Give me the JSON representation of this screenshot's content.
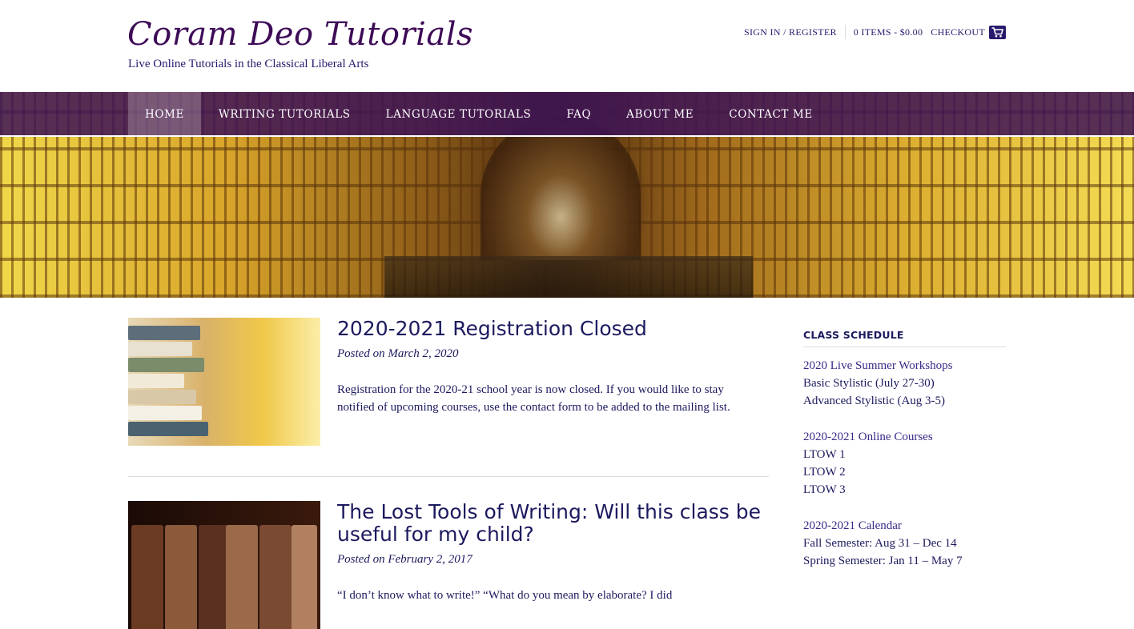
{
  "site": {
    "title": "Coram Deo Tutorials",
    "tagline": "Live Online Tutorials in the Classical Liberal Arts"
  },
  "topbar": {
    "signin": "SIGN IN / REGISTER",
    "cart_summary": "0 ITEMS - $0.00",
    "checkout": "CHECKOUT",
    "cart_icon": "shopping-cart-icon"
  },
  "nav": {
    "items": [
      "HOME",
      "WRITING TUTORIALS",
      "LANGUAGE TUTORIALS",
      "FAQ",
      "ABOUT ME",
      "CONTACT ME"
    ],
    "active": "HOME"
  },
  "posts": [
    {
      "title": "2020-2021 Registration Closed",
      "meta": "Posted on March 2, 2020",
      "excerpt": "Registration for the 2020-21 school year is now closed. If you would like to stay notified of upcoming courses, use the contact form to be added to the mailing list."
    },
    {
      "title": "The Lost Tools of Writing: Will this class be useful for my child?",
      "meta": "Posted on February 2, 2017",
      "excerpt": "“I don’t know what to write!” “What do you mean by elaborate? I did"
    }
  ],
  "sidebar": {
    "heading": "CLASS SCHEDULE",
    "groups": [
      {
        "head": "2020 Live Summer Workshops",
        "lines": [
          "Basic Stylistic (July 27-30)",
          "Advanced Stylistic (Aug 3-5)"
        ]
      },
      {
        "head": "2020-2021 Online Courses",
        "lines": [
          "LTOW 1",
          "LTOW 2",
          "LTOW 3"
        ]
      },
      {
        "head": "2020-2021 Calendar",
        "lines": [
          "Fall Semester: Aug 31 – Dec 14",
          "Spring Semester: Jan 11 – May 7"
        ]
      }
    ]
  },
  "colors": {
    "brand_purple": "#3e0b57",
    "text_navy": "#1c1a5e",
    "nav_bg": "#3e1456"
  }
}
